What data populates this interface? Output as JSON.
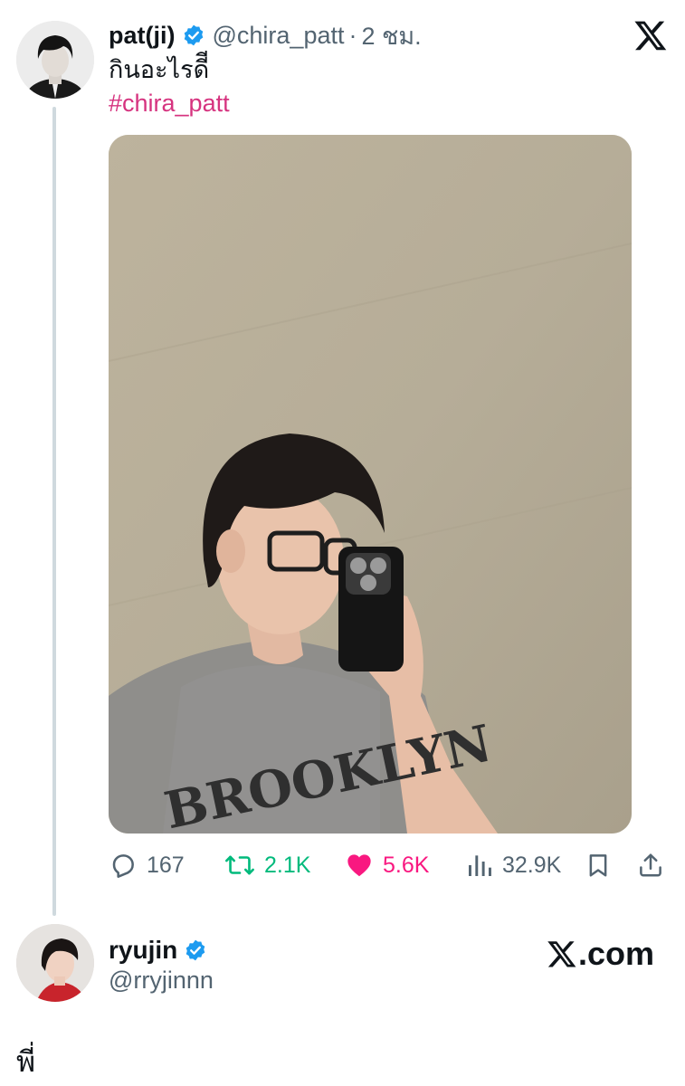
{
  "tweet": {
    "author": {
      "display_name": "pat(ji)",
      "handle": "@chira_patt",
      "verified": true
    },
    "separator": "·",
    "time": "2 ชม.",
    "text": "กินอะไรดีี",
    "hashtag": "#chira_patt",
    "media": {
      "description": "mirror selfie photo",
      "shirt_text": "BROOKLYN"
    },
    "stats": {
      "replies": "167",
      "retweets": "2.1K",
      "likes": "5.6K",
      "views": "32.9K"
    }
  },
  "reply": {
    "author": {
      "display_name": "ryujin",
      "handle": "@rryjinnn",
      "verified": true
    },
    "text": "พี่"
  },
  "branding": {
    "site_label": ".com"
  },
  "colors": {
    "verified_blue": "#1d9bf0",
    "hashtag_pink": "#d6337f",
    "retweet_green": "#00ba7c",
    "like_pink": "#f91880",
    "muted_gray": "#536471"
  },
  "icons": [
    "x-logo-icon",
    "verified-badge-icon",
    "reply-icon",
    "retweet-icon",
    "like-heart-icon",
    "views-chart-icon",
    "bookmark-icon",
    "share-icon"
  ]
}
